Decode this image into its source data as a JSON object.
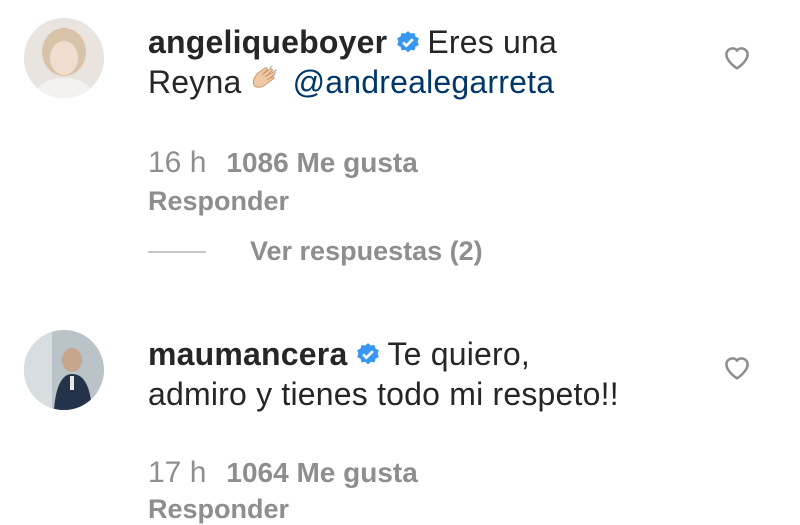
{
  "comments": [
    {
      "username": "angeliqueboyer",
      "text_a": "Eres una",
      "text_b": "Reyna",
      "emoji": "clapping-hands-icon",
      "mention": "@andrealegarreta",
      "time": "16 h",
      "likes": "1086 Me gusta",
      "reply": "Responder",
      "view_replies": "Ver respuestas (2)"
    },
    {
      "username": "maumancera",
      "text_a": "Te quiero,",
      "text_b": "admiro y tienes todo mi respeto!!",
      "time": "17 h",
      "likes": "1064 Me gusta",
      "reply": "Responder"
    }
  ],
  "colors": {
    "verified": "#3897f0",
    "mention": "#00376b",
    "meta": "#8e8e8e"
  }
}
